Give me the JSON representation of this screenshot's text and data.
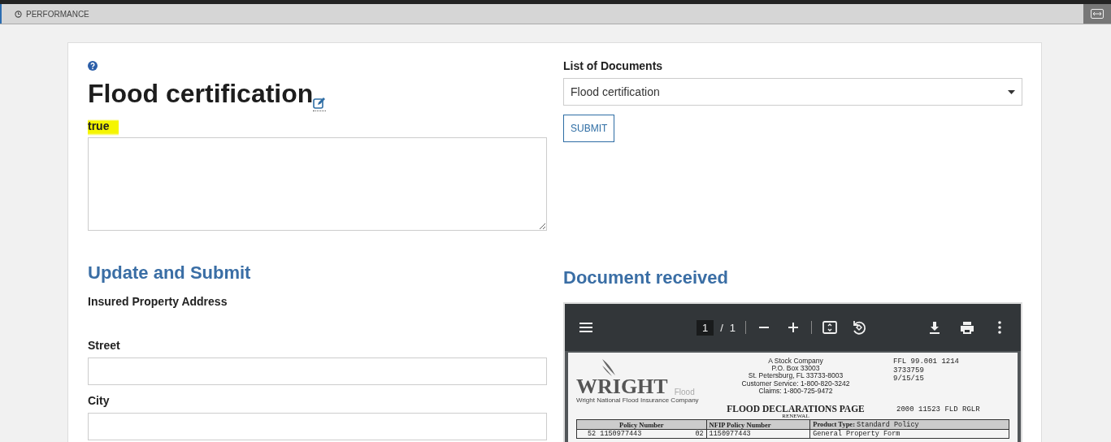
{
  "top_tab": {
    "label": "PERFORMANCE",
    "selected": true
  },
  "certification": {
    "title": "Flood certification",
    "status": "true"
  },
  "documents": {
    "label": "List of Documents",
    "selected_document": "Flood certification",
    "submit": "SUBMIT"
  },
  "update": {
    "heading": "Update and Submit",
    "subheading": "Insured Property Address",
    "fields": [
      {
        "label": "Street"
      },
      {
        "label": "City"
      }
    ]
  },
  "received": {
    "heading": "Document received",
    "viewer": {
      "page_current": "1",
      "page_separator": "/",
      "page_total": "1"
    },
    "document": {
      "logo": "WRIGHT",
      "logo_tagline": "Wright National Flood Insurance Company",
      "logo_sub": "Flood",
      "company_lines": [
        "A Stock Company",
        "P.O. Box 33003",
        "St. Petersburg, FL 33733-8003",
        "Customer Service: 1-800-820-3242",
        "Claims: 1-800-725-9472"
      ],
      "codes": [
        "FFL 99.001 1214",
        "3733759",
        "9/15/15"
      ],
      "title": "FLOOD DECLARATIONS PAGE",
      "subtitle": "RENEWAL",
      "reference": "2000 11523 FLD  RGLR",
      "table_header": {
        "policy_number": "Policy Number",
        "nfip_policy_number": "NFIP Policy Number",
        "product_type_label": "Product Type:",
        "product_type": "Standard Policy"
      },
      "table_row": {
        "policy_number": "52 1150977443",
        "policy_suffix": "02",
        "nfip_policy_number": "1150977443",
        "form": "General Property Form"
      }
    }
  }
}
